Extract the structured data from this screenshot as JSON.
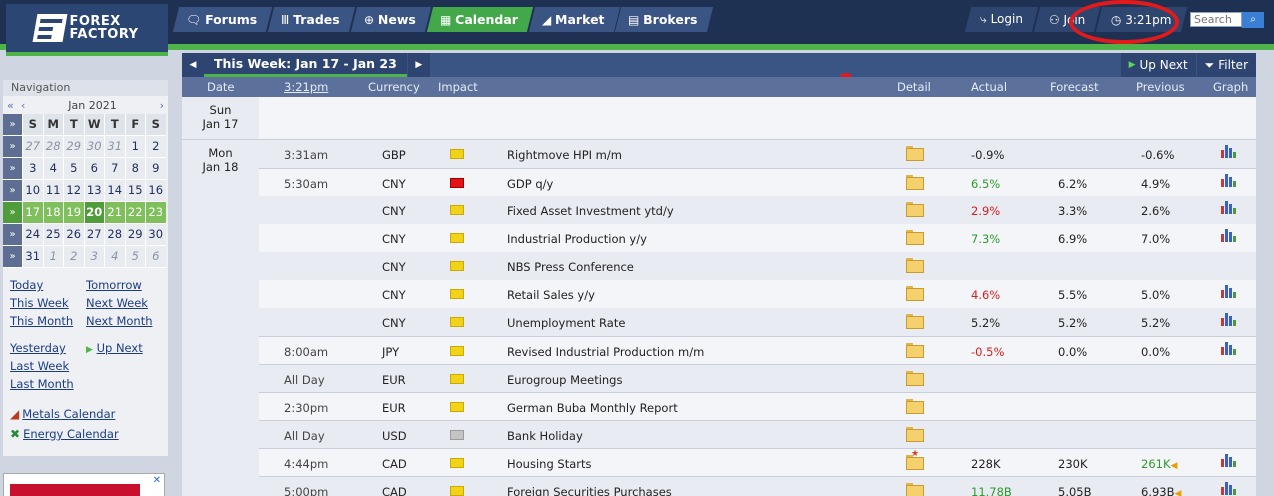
{
  "header": {
    "logo_line1": "FOREX",
    "logo_line2": "FACTORY",
    "tabs": [
      {
        "label": "Forums",
        "icon": "forums-icon",
        "glyph": "🗨",
        "active": false
      },
      {
        "label": "Trades",
        "icon": "trades-icon",
        "glyph": "Ⅲ",
        "active": false
      },
      {
        "label": "News",
        "icon": "news-icon",
        "glyph": "⊕",
        "active": false
      },
      {
        "label": "Calendar",
        "icon": "calendar-icon",
        "glyph": "▦",
        "active": true
      },
      {
        "label": "Market",
        "icon": "market-icon",
        "glyph": "◢",
        "active": false
      },
      {
        "label": "Brokers",
        "icon": "brokers-icon",
        "glyph": "▤",
        "active": false
      }
    ],
    "login_label": "Login",
    "join_label": "Join",
    "time_label": "3:21pm",
    "search_placeholder": "Search"
  },
  "sidebar": {
    "navigation_label": "Navigation",
    "month_label": "Jan 2021",
    "weekday_headers": [
      "S",
      "M",
      "T",
      "W",
      "T",
      "F",
      "S"
    ],
    "weeks": [
      {
        "days": [
          "27",
          "28",
          "29",
          "30",
          "31",
          "1",
          "2"
        ],
        "dim": [
          true,
          true,
          true,
          true,
          true,
          false,
          false
        ],
        "current": false
      },
      {
        "days": [
          "3",
          "4",
          "5",
          "6",
          "7",
          "8",
          "9"
        ],
        "dim": [
          false,
          false,
          false,
          false,
          false,
          false,
          false
        ],
        "current": false
      },
      {
        "days": [
          "10",
          "11",
          "12",
          "13",
          "14",
          "15",
          "16"
        ],
        "dim": [
          false,
          false,
          false,
          false,
          false,
          false,
          false
        ],
        "current": false
      },
      {
        "days": [
          "17",
          "18",
          "19",
          "20",
          "21",
          "22",
          "23"
        ],
        "dim": [
          false,
          false,
          false,
          false,
          false,
          false,
          false
        ],
        "current": true,
        "today_index": 3
      },
      {
        "days": [
          "24",
          "25",
          "26",
          "27",
          "28",
          "29",
          "30"
        ],
        "dim": [
          false,
          false,
          false,
          false,
          false,
          false,
          false
        ],
        "current": false
      },
      {
        "days": [
          "31",
          "1",
          "2",
          "3",
          "4",
          "5",
          "6"
        ],
        "dim": [
          false,
          true,
          true,
          true,
          true,
          true,
          true
        ],
        "current": false
      }
    ],
    "links": {
      "today": "Today",
      "tomorrow": "Tomorrow",
      "this_week": "This Week",
      "next_week": "Next Week",
      "this_month": "This Month",
      "next_month": "Next Month",
      "yesterday": "Yesterday",
      "up_next": "Up Next",
      "last_week": "Last Week",
      "last_month": "Last Month",
      "metals": "Metals Calendar",
      "energy": "Energy Calendar"
    }
  },
  "calendar": {
    "week_title": "This Week: Jan 17 - Jan 23",
    "up_next_label": "Up Next",
    "filter_label": "Filter",
    "columns": {
      "date": "Date",
      "time": "3:21pm",
      "currency": "Currency",
      "impact": "Impact",
      "detail": "Detail",
      "actual": "Actual",
      "forecast": "Forecast",
      "previous": "Previous",
      "graph": "Graph"
    },
    "days": [
      {
        "day": "Sun",
        "date": "Jan 17",
        "events": []
      },
      {
        "day": "Mon",
        "date": "Jan 18",
        "events": [
          {
            "time": "3:31am",
            "currency": "GBP",
            "impact": "yellow",
            "name": "Rightmove HPI m/m",
            "actual": "-0.9%",
            "actual_color": "neutral",
            "forecast": "",
            "previous": "-0.6%",
            "graph": true
          },
          {
            "time": "5:30am",
            "currency": "CNY",
            "impact": "red",
            "name": "GDP q/y",
            "actual": "6.5%",
            "actual_color": "green",
            "forecast": "6.2%",
            "previous": "4.9%",
            "graph": true
          },
          {
            "time": "",
            "currency": "CNY",
            "impact": "yellow",
            "name": "Fixed Asset Investment ytd/y",
            "actual": "2.9%",
            "actual_color": "red",
            "forecast": "3.3%",
            "previous": "2.6%",
            "graph": true
          },
          {
            "time": "",
            "currency": "CNY",
            "impact": "yellow",
            "name": "Industrial Production y/y",
            "actual": "7.3%",
            "actual_color": "green",
            "forecast": "6.9%",
            "previous": "7.0%",
            "graph": true
          },
          {
            "time": "",
            "currency": "CNY",
            "impact": "yellow",
            "name": "NBS Press Conference",
            "actual": "",
            "actual_color": "neutral",
            "forecast": "",
            "previous": "",
            "graph": false
          },
          {
            "time": "",
            "currency": "CNY",
            "impact": "yellow",
            "name": "Retail Sales y/y",
            "actual": "4.6%",
            "actual_color": "red",
            "forecast": "5.5%",
            "previous": "5.0%",
            "graph": true
          },
          {
            "time": "",
            "currency": "CNY",
            "impact": "yellow",
            "name": "Unemployment Rate",
            "actual": "5.2%",
            "actual_color": "neutral",
            "forecast": "5.2%",
            "previous": "5.2%",
            "graph": true
          },
          {
            "time": "8:00am",
            "currency": "JPY",
            "impact": "yellow",
            "name": "Revised Industrial Production m/m",
            "actual": "-0.5%",
            "actual_color": "red",
            "forecast": "0.0%",
            "previous": "0.0%",
            "graph": true
          },
          {
            "time": "All Day",
            "currency": "EUR",
            "impact": "yellow",
            "name": "Eurogroup Meetings",
            "actual": "",
            "actual_color": "neutral",
            "forecast": "",
            "previous": "",
            "graph": false
          },
          {
            "time": "2:30pm",
            "currency": "EUR",
            "impact": "yellow",
            "name": "German Buba Monthly Report",
            "actual": "",
            "actual_color": "neutral",
            "forecast": "",
            "previous": "",
            "graph": false
          },
          {
            "time": "All Day",
            "currency": "USD",
            "impact": "gray",
            "name": "Bank Holiday",
            "actual": "",
            "actual_color": "neutral",
            "forecast": "",
            "previous": "",
            "graph": false
          },
          {
            "time": "4:44pm",
            "currency": "CAD",
            "impact": "yellow",
            "name": "Housing Starts",
            "actual": "228K",
            "actual_color": "neutral",
            "forecast": "230K",
            "previous": "261K",
            "previous_color": "green",
            "revised": true,
            "graph": true,
            "detail_new": true
          },
          {
            "time": "5:00pm",
            "currency": "CAD",
            "impact": "yellow",
            "name": "Foreign Securities Purchases",
            "actual": "11.78B",
            "actual_color": "green",
            "forecast": "5.05B",
            "previous": "6.93B",
            "revised": true,
            "graph": true
          }
        ]
      }
    ]
  },
  "colors": {
    "header_bg": "#1f3152",
    "tab_bg": "#3a5583",
    "tab_active": "#43a84a",
    "accent_green": "#4eb34a",
    "actual_green": "#2d9a2d",
    "actual_red": "#d22020",
    "highlight_red": "#e41a1a"
  }
}
